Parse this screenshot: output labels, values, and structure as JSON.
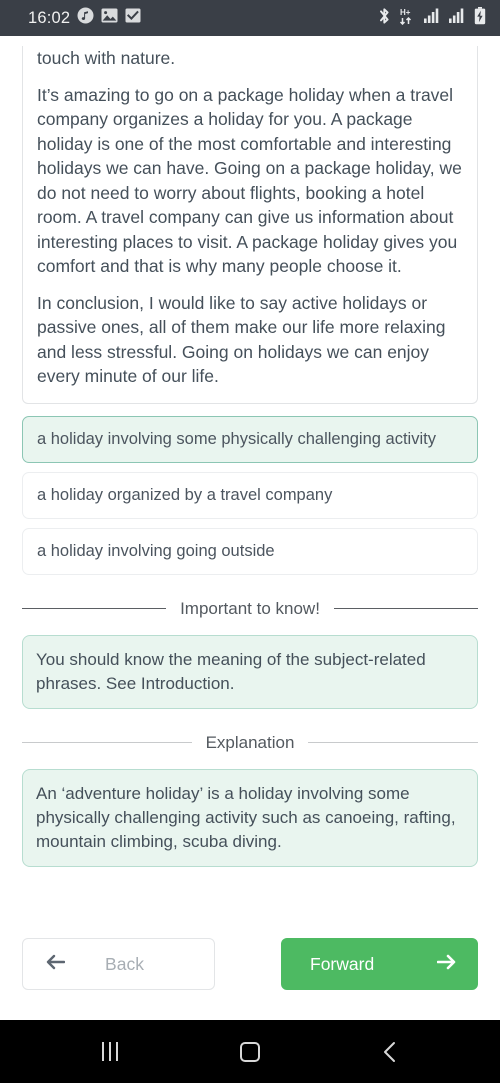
{
  "status_bar": {
    "time": "16:02",
    "left_icons": [
      "music-note-icon",
      "gallery-image-icon",
      "checkbox-check-icon"
    ],
    "right_icons": [
      "bluetooth-icon",
      "hplus-data-icon",
      "signal-bars-icon-1",
      "signal-bars-icon-2",
      "battery-charging-icon"
    ],
    "background_color": "#3a3f47"
  },
  "article": {
    "paragraphs": [
      "touch with nature.",
      "It’s amazing to go on a package holiday when a travel company organizes a holiday for you. A package holiday is one of the most comfortable and interesting holidays we can have. Going on a package holiday, we do not need to worry about flights, booking a hotel room. A travel company can give us information about interesting places to visit. A package holiday gives you comfort and that is why many people choose it.",
      "In conclusion, I would like to say active holidays or passive ones, all of them make our life more relaxing and less stressful. Going on holidays we can enjoy every minute of our life."
    ]
  },
  "options": [
    {
      "label": "a holiday involving some physically challenging activity",
      "selected": true
    },
    {
      "label": "a holiday organized by a travel company",
      "selected": false
    },
    {
      "label": "a holiday involving going outside",
      "selected": false
    }
  ],
  "sections": {
    "important": {
      "title": "Important to know!",
      "body": "You should know the meaning of the subject-related phrases. See Introduction."
    },
    "explanation": {
      "title": "Explanation",
      "body": "An ‘adventure holiday’ is a holiday involving some physically challenging activity such as canoeing, rafting, mountain climbing, scuba diving."
    }
  },
  "footer": {
    "back_label": "Back",
    "back_icon": "arrow-left-icon",
    "forward_label": "Forward",
    "forward_icon": "arrow-right-icon",
    "forward_color": "#4dba62"
  },
  "navbar": {
    "recents": "recents-icon",
    "home": "home-icon",
    "back": "back-chevron-icon"
  },
  "colors": {
    "selected_bg": "#e9f5ef",
    "selected_border": "#8cc6b4",
    "text": "#45505a",
    "accent_green": "#4dba62"
  }
}
